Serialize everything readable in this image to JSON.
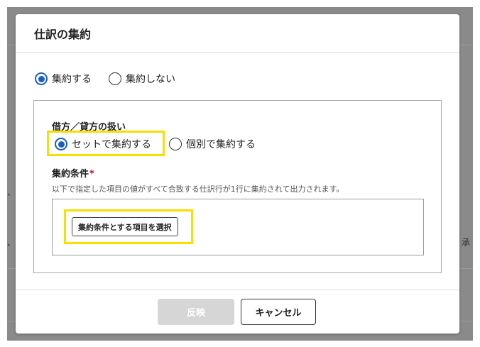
{
  "background": {
    "left_fragment_1": "、",
    "left_fragment_2": "、",
    "right_fragment": "承"
  },
  "modal": {
    "title": "仕訳の集約",
    "aggregate_mode": {
      "options": [
        {
          "label": "集約する",
          "checked": true
        },
        {
          "label": "集約しない",
          "checked": false
        }
      ]
    },
    "debit_credit": {
      "title": "借方／貸方の扱い",
      "options": [
        {
          "label": "セットで集約する",
          "checked": true
        },
        {
          "label": "個別で集約する",
          "checked": false
        }
      ]
    },
    "conditions": {
      "title": "集約条件",
      "required_mark": "*",
      "hint": "以下で指定した項目の値がすべて合致する仕訳行が1行に集約されて出力されます。",
      "select_button": "集約条件とする項目を選択"
    },
    "footer": {
      "apply_label": "反映",
      "cancel_label": "キャンセル"
    }
  },
  "colors": {
    "accent": "#1a5dc8",
    "highlight": "#f5e000",
    "required": "#d0021b",
    "disabled_button": "#d6d6d6",
    "backdrop": "#8a8a8a"
  }
}
